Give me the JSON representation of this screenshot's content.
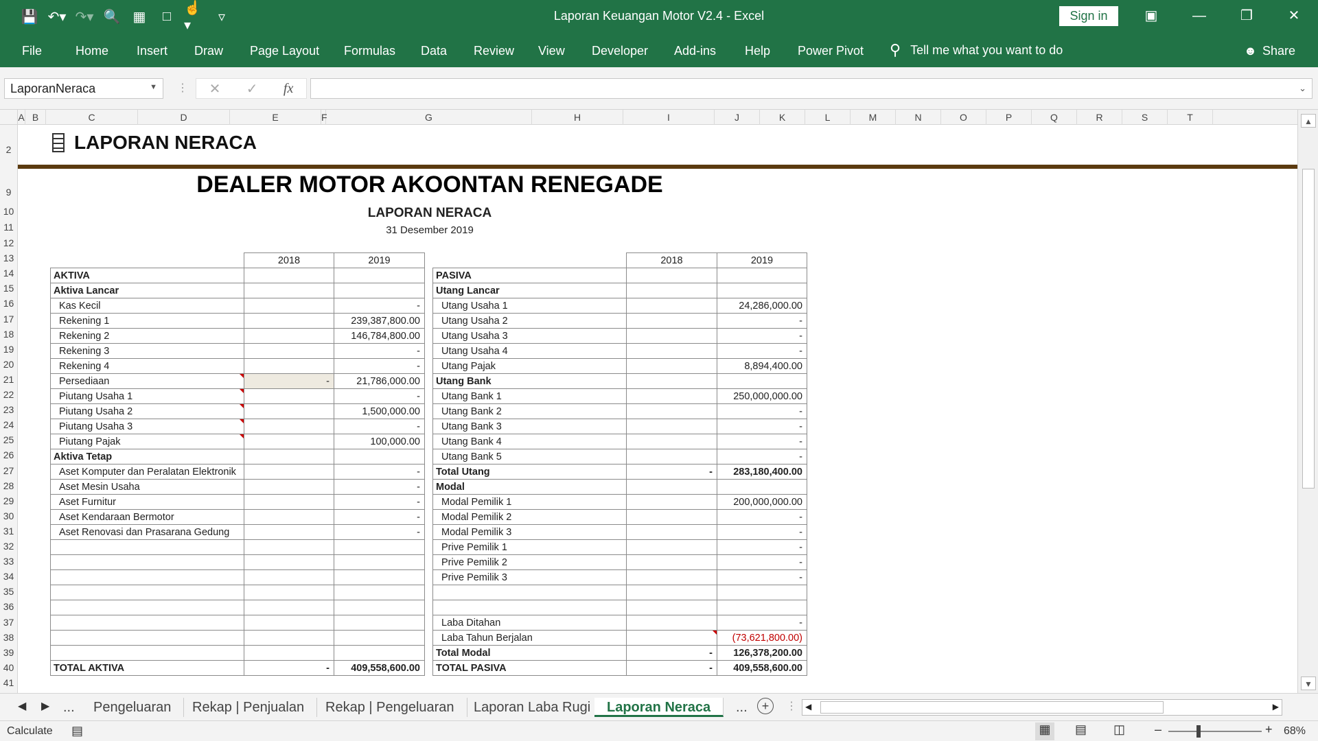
{
  "window": {
    "title": "Laporan Keuangan Motor V2.4  -  Excel",
    "sign_in": "Sign in"
  },
  "qat_icons": [
    "save-icon",
    "undo-icon",
    "redo-icon",
    "print-preview-icon",
    "form-icon",
    "new-document-icon",
    "touch-mode-icon",
    "customize-qat-icon"
  ],
  "ribbon": {
    "tabs": [
      "File",
      "Home",
      "Insert",
      "Draw",
      "Page Layout",
      "Formulas",
      "Data",
      "Review",
      "View",
      "Developer",
      "Add-ins",
      "Help",
      "Power Pivot"
    ],
    "tell_me": "Tell me what you want to do",
    "share": "Share"
  },
  "formula_bar": {
    "name_box": "LaporanNeraca",
    "fx": "fx",
    "value": ""
  },
  "columns": [
    "A",
    "B",
    "C",
    "D",
    "E",
    "F",
    "G",
    "H",
    "I",
    "J",
    "K",
    "L",
    "M",
    "N",
    "O",
    "P",
    "Q",
    "R",
    "S",
    "T"
  ],
  "rows": [
    "2",
    "9",
    "10",
    "11",
    "12",
    "13",
    "14",
    "15",
    "16",
    "17",
    "18",
    "19",
    "20",
    "21",
    "22",
    "23",
    "24",
    "25",
    "26",
    "27",
    "28",
    "29",
    "30",
    "31",
    "32",
    "33",
    "34",
    "35",
    "36",
    "37",
    "38",
    "39",
    "40",
    "41"
  ],
  "sheet": {
    "header_title": "LAPORAN NERACA",
    "company": "DEALER MOTOR AKOONTAN RENEGADE",
    "report_title": "LAPORAN NERACA",
    "report_date": "31 Desember 2019",
    "year1": "2018",
    "year2": "2019"
  },
  "aktiva": [
    {
      "label": "AKTIVA",
      "y1": "",
      "y2": "",
      "style": "bold"
    },
    {
      "label": "Aktiva Lancar",
      "y1": "",
      "y2": "",
      "style": "bold"
    },
    {
      "label": "Kas Kecil",
      "y1": "",
      "y2": "-",
      "style": "indent"
    },
    {
      "label": "Rekening 1",
      "y1": "",
      "y2": "239,387,800.00",
      "style": "indent"
    },
    {
      "label": "Rekening 2",
      "y1": "",
      "y2": "146,784,800.00",
      "style": "indent"
    },
    {
      "label": "Rekening 3",
      "y1": "",
      "y2": "-",
      "style": "indent"
    },
    {
      "label": "Rekening 4",
      "y1": "",
      "y2": "-",
      "style": "indent"
    },
    {
      "label": "Persediaan",
      "y1": "-",
      "y2": "21,786,000.00",
      "style": "indent",
      "note": true,
      "hl": true
    },
    {
      "label": "Piutang Usaha 1",
      "y1": "",
      "y2": "-",
      "style": "indent",
      "note": true
    },
    {
      "label": "Piutang Usaha 2",
      "y1": "",
      "y2": "1,500,000.00",
      "style": "indent",
      "note": true
    },
    {
      "label": "Piutang Usaha 3",
      "y1": "",
      "y2": "-",
      "style": "indent",
      "note": true
    },
    {
      "label": "Piutang Pajak",
      "y1": "",
      "y2": "100,000.00",
      "style": "indent",
      "note": true
    },
    {
      "label": "Aktiva Tetap",
      "y1": "",
      "y2": "",
      "style": "bold"
    },
    {
      "label": "Aset Komputer dan Peralatan Elektronik",
      "y1": "",
      "y2": "-",
      "style": "indent"
    },
    {
      "label": "Aset Mesin Usaha",
      "y1": "",
      "y2": "-",
      "style": "indent"
    },
    {
      "label": "Aset Furnitur",
      "y1": "",
      "y2": "-",
      "style": "indent"
    },
    {
      "label": "Aset Kendaraan Bermotor",
      "y1": "",
      "y2": "-",
      "style": "indent"
    },
    {
      "label": "Aset Renovasi dan Prasarana Gedung",
      "y1": "",
      "y2": "-",
      "style": "indent"
    },
    {
      "label": "",
      "y1": "",
      "y2": "",
      "style": "indent"
    },
    {
      "label": "",
      "y1": "",
      "y2": "",
      "style": "indent"
    },
    {
      "label": "",
      "y1": "",
      "y2": "",
      "style": "indent"
    },
    {
      "label": "",
      "y1": "",
      "y2": "",
      "style": "indent"
    },
    {
      "label": "",
      "y1": "",
      "y2": "",
      "style": "indent"
    },
    {
      "label": "",
      "y1": "",
      "y2": "",
      "style": "indent"
    },
    {
      "label": "",
      "y1": "",
      "y2": "",
      "style": "indent"
    },
    {
      "label": "",
      "y1": "",
      "y2": "",
      "style": "indent"
    },
    {
      "label": "TOTAL AKTIVA",
      "y1": "-",
      "y2": "409,558,600.00",
      "style": "bold"
    }
  ],
  "pasiva": [
    {
      "label": "PASIVA",
      "y1": "",
      "y2": "",
      "style": "bold"
    },
    {
      "label": "Utang Lancar",
      "y1": "",
      "y2": "",
      "style": "bold"
    },
    {
      "label": "Utang Usaha 1",
      "y1": "",
      "y2": "24,286,000.00",
      "style": "indent"
    },
    {
      "label": "Utang Usaha 2",
      "y1": "",
      "y2": "-",
      "style": "indent"
    },
    {
      "label": "Utang Usaha 3",
      "y1": "",
      "y2": "-",
      "style": "indent"
    },
    {
      "label": "Utang Usaha 4",
      "y1": "",
      "y2": "-",
      "style": "indent"
    },
    {
      "label": "Utang Pajak",
      "y1": "",
      "y2": "8,894,400.00",
      "style": "indent"
    },
    {
      "label": "Utang Bank",
      "y1": "",
      "y2": "",
      "style": "bold"
    },
    {
      "label": "Utang Bank 1",
      "y1": "",
      "y2": "250,000,000.00",
      "style": "indent"
    },
    {
      "label": "Utang Bank 2",
      "y1": "",
      "y2": "-",
      "style": "indent"
    },
    {
      "label": "Utang Bank 3",
      "y1": "",
      "y2": "-",
      "style": "indent"
    },
    {
      "label": "Utang Bank 4",
      "y1": "",
      "y2": "-",
      "style": "indent"
    },
    {
      "label": "Utang Bank 5",
      "y1": "",
      "y2": "-",
      "style": "indent"
    },
    {
      "label": "Total Utang",
      "y1": "-",
      "y2": "283,180,400.00",
      "style": "bold"
    },
    {
      "label": "Modal",
      "y1": "",
      "y2": "",
      "style": "bold"
    },
    {
      "label": "Modal Pemilik 1",
      "y1": "",
      "y2": "200,000,000.00",
      "style": "indent"
    },
    {
      "label": "Modal Pemilik 2",
      "y1": "",
      "y2": "-",
      "style": "indent"
    },
    {
      "label": "Modal Pemilik 3",
      "y1": "",
      "y2": "-",
      "style": "indent"
    },
    {
      "label": "Prive Pemilik 1",
      "y1": "",
      "y2": "-",
      "style": "indent"
    },
    {
      "label": "Prive Pemilik 2",
      "y1": "",
      "y2": "-",
      "style": "indent"
    },
    {
      "label": "Prive Pemilik 3",
      "y1": "",
      "y2": "-",
      "style": "indent"
    },
    {
      "label": "",
      "y1": "",
      "y2": "",
      "style": "indent"
    },
    {
      "label": "",
      "y1": "",
      "y2": "",
      "style": "indent"
    },
    {
      "label": "Laba Ditahan",
      "y1": "",
      "y2": "-",
      "style": "indent"
    },
    {
      "label": "Laba Tahun Berjalan",
      "y1": "",
      "y2": "(73,621,800.00)",
      "style": "indent",
      "note_y1": true,
      "red": true
    },
    {
      "label": "Total Modal",
      "y1": "-",
      "y2": "126,378,200.00",
      "style": "bold"
    },
    {
      "label": "TOTAL PASIVA",
      "y1": "-",
      "y2": "409,558,600.00",
      "style": "bold"
    }
  ],
  "sheet_tabs": {
    "items": [
      "...",
      "Pengeluaran",
      "Rekap | Penjualan",
      "Rekap | Pengeluaran",
      "Laporan Laba Rugi",
      "Laporan Neraca",
      "..."
    ],
    "active": "Laporan Neraca"
  },
  "status": {
    "mode": "Calculate",
    "zoom": "68%",
    "zoom_level_percent": 68
  }
}
